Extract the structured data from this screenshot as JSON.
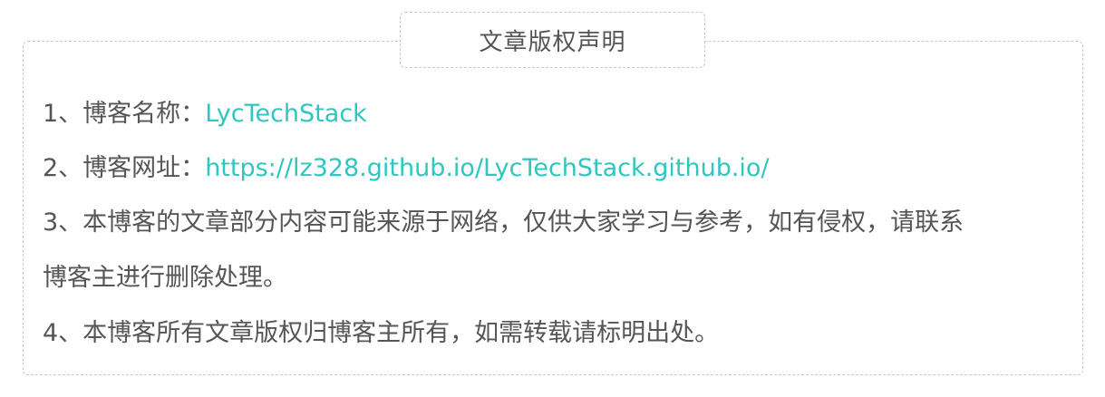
{
  "title": "文章版权声明",
  "items": [
    {
      "prefix": "1、博客名称：",
      "value": "LycTechStack"
    },
    {
      "prefix": "2、博客网址：",
      "value": "https://lz328.github.io/LycTechStack.github.io/"
    },
    {
      "text_line1": "3、本博客的文章部分内容可能来源于网络，仅供大家学习与参考，如有侵权，请联系",
      "text_line2": "博客主进行删除处理。"
    },
    {
      "text": "4、本博客所有文章版权归博客主所有，如需转载请标明出处。"
    }
  ],
  "colors": {
    "text": "#555555",
    "link": "#2ec7c0",
    "border": "#c8c8c8"
  }
}
